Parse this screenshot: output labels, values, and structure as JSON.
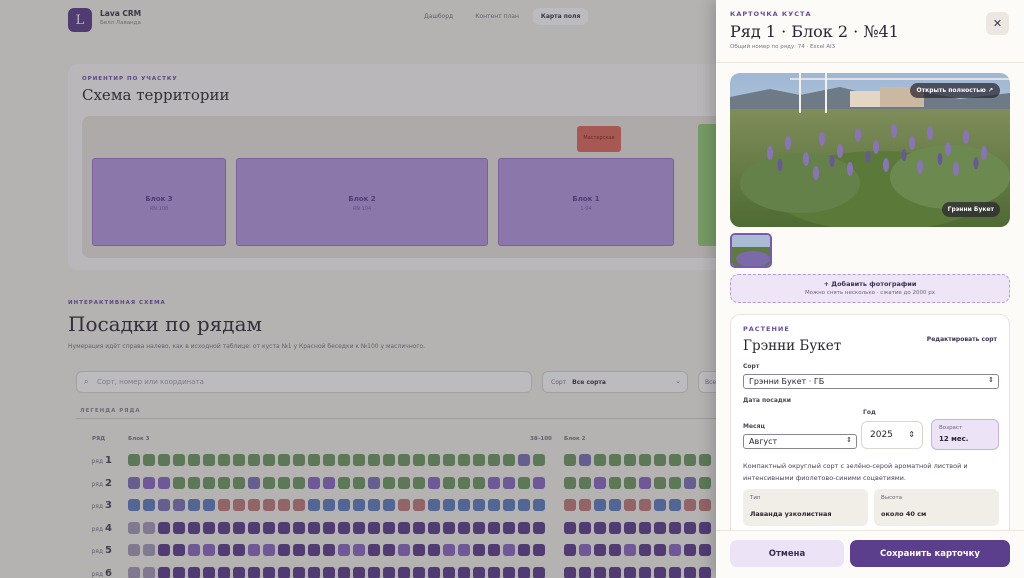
{
  "app": {
    "logo_letter": "L",
    "name": "Lava CRM",
    "subtitle": "Белл Лаванда",
    "nav": [
      "Дашборд",
      "Контент план",
      "Карта поля"
    ]
  },
  "territory": {
    "kicker": "ОРИЕНТИР ПО УЧАСТКУ",
    "title": "Схема территории",
    "blocks": [
      {
        "name": "Блок 3",
        "sub": "RN 108"
      },
      {
        "name": "Блок 2",
        "sub": "RN 104"
      },
      {
        "name": "Блок 1",
        "sub": "1-94"
      }
    ],
    "red_tag": "Мастерская"
  },
  "plantings": {
    "kicker": "ИНТЕРАКТИВНАЯ СХЕМА",
    "title": "Посадки по рядам",
    "subtitle": "Нумерация идёт справа налево, как в исходной таблице: от куста №1 у Красной беседки к №100 у масличного.",
    "search_placeholder": "Сорт, номер или координата",
    "sort_label": "Сорт",
    "sort_value": "Все сорта",
    "second_select": "Все",
    "legend_label": "ЛЕГЕНДА РЯДА",
    "col_row": "РЯД",
    "col_block3": "Блок 3",
    "col_block2": "Блок 2",
    "col_range": "38–100",
    "rows": [
      {
        "prefix": "ряд",
        "num": "1"
      },
      {
        "prefix": "ряд",
        "num": "2"
      },
      {
        "prefix": "ряд",
        "num": "3"
      },
      {
        "prefix": "ряд",
        "num": "4"
      },
      {
        "prefix": "ряд",
        "num": "5"
      },
      {
        "prefix": "ряд",
        "num": "6"
      }
    ]
  },
  "drawer": {
    "kicker": "КАРТОЧКА КУСТА",
    "title": "Ряд 1 · Блок 2 · №41",
    "subtitle": "Общий номер по ряду: 74 · Excel AI3",
    "close_icon": "close-icon",
    "open_full": "Открыть полностью ↗",
    "photo_caption": "Грэнни Букет",
    "add_photo_title": "+ Добавить фотографии",
    "add_photo_hint": "Можно снять несколько · сжатие до 2000 px",
    "plant": {
      "kicker": "РАСТЕНИЕ",
      "name": "Грэнни Букет",
      "edit_link": "Редактировать сорт",
      "variety_label": "Сорт",
      "variety_value": "Грэнни Букет · ГБ",
      "planting_date_label": "Дата посадки",
      "month_label": "Месяц",
      "month_value": "Август",
      "year_label": "Год",
      "year_value": "2025",
      "age_label": "Возраст",
      "age_value": "12 мес.",
      "description": "Компактный округлый сорт с зелёно-серой ароматной листвой и интенсивными фиолетово-синими соцветиями.",
      "type_label": "Тип",
      "type_value": "Лаванда узколистная",
      "height_label": "Высота",
      "height_value": "около 40 см"
    },
    "cancel_label": "Отмена",
    "save_label": "Сохранить карточку"
  },
  "colors": {
    "accent": "#5b3f8c",
    "accent_light": "#ece3f7",
    "block_purple": "#b798df",
    "green_zone": "#95cf79",
    "red_tag": "#e06a5a"
  }
}
